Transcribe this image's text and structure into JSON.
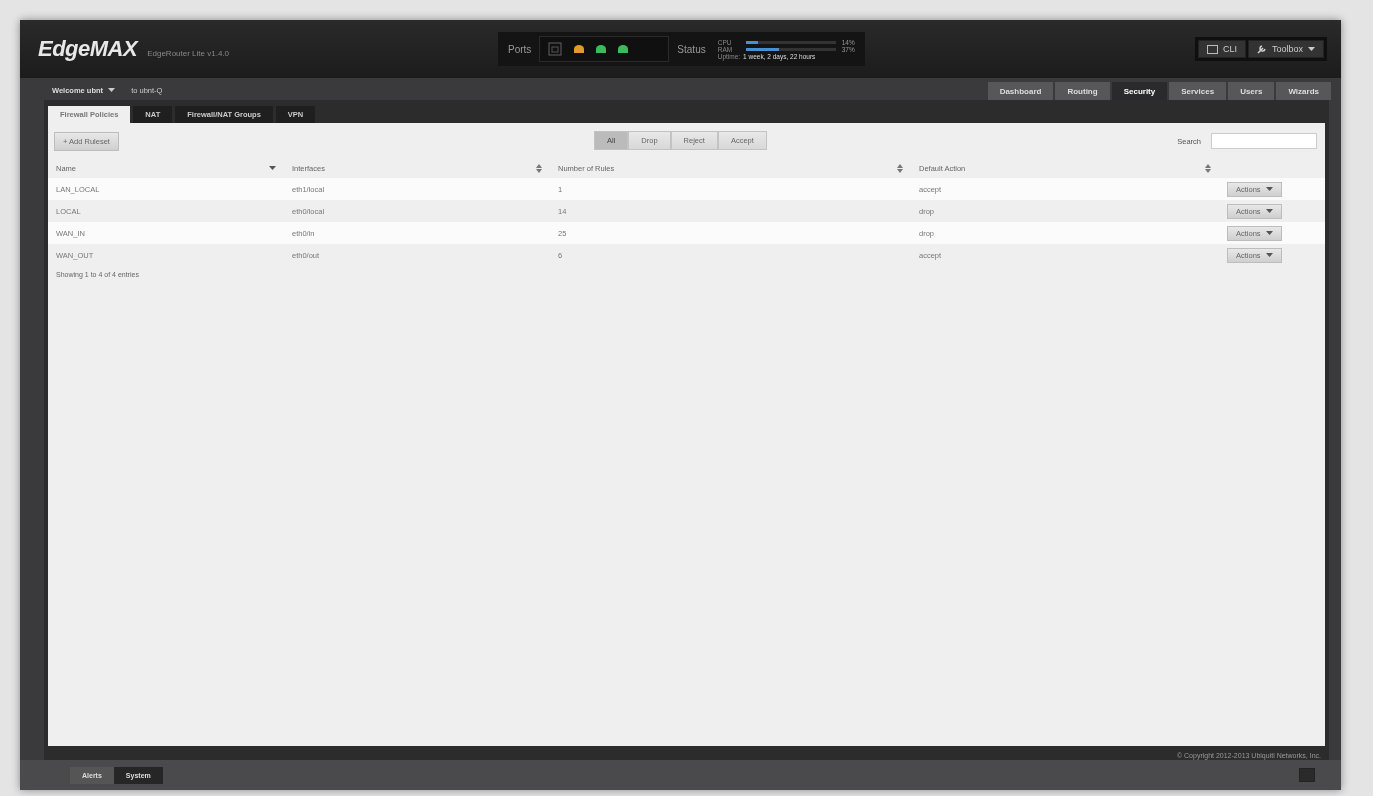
{
  "header": {
    "logo": "EdgeMAX",
    "product": "EdgeRouter Lite v1.4.0",
    "ports": {
      "label": "Ports",
      "leds": [
        {
          "color": "#e39a2c"
        },
        {
          "color": "#3dbb5a"
        },
        {
          "color": "#3dbb5a"
        }
      ]
    },
    "status": {
      "label": "Status",
      "meters": [
        {
          "name": "CPU",
          "level": 0.14,
          "reading": "14%"
        },
        {
          "name": "RAM",
          "level": 0.37,
          "reading": "37%"
        }
      ],
      "uptime_label": "Uptime:",
      "uptime": "1 week, 2 days, 22 hours"
    },
    "buttons": [
      {
        "kind": "cli",
        "label": "CLI"
      },
      {
        "kind": "toolbox",
        "label": "Toolbox"
      }
    ]
  },
  "user": {
    "welcome": "Welcome ubnt",
    "host": "to ubnt-Q"
  },
  "nav_tabs": [
    {
      "label": "Dashboard",
      "selected": false
    },
    {
      "label": "Routing",
      "selected": false
    },
    {
      "label": "Security",
      "selected": true
    },
    {
      "label": "Services",
      "selected": false
    },
    {
      "label": "Users",
      "selected": false
    },
    {
      "label": "Wizards",
      "selected": false
    }
  ],
  "sub_tabs": [
    {
      "label": "Firewall Policies",
      "selected": true
    },
    {
      "label": "NAT",
      "selected": false
    },
    {
      "label": "Firewall/NAT Groups",
      "selected": false
    },
    {
      "label": "VPN",
      "selected": false
    }
  ],
  "add_button": "+ Add Ruleset",
  "filters": [
    {
      "label": "All",
      "selected": true
    },
    {
      "label": "Drop",
      "selected": false
    },
    {
      "label": "Reject",
      "selected": false
    },
    {
      "label": "Accept",
      "selected": false
    }
  ],
  "search": {
    "label": "Search"
  },
  "table": {
    "columns": [
      {
        "label": "Name",
        "sorted": true
      },
      {
        "label": "Interfaces",
        "sorted": false
      },
      {
        "label": "Number of Rules",
        "sorted": false
      },
      {
        "label": "Default Action",
        "sorted": false
      }
    ],
    "rows": [
      {
        "cells": [
          "LAN_LOCAL",
          "eth1/local",
          "1",
          "accept"
        ],
        "action": "Actions"
      },
      {
        "cells": [
          "LOCAL",
          "eth0/local",
          "14",
          "drop"
        ],
        "action": "Actions"
      },
      {
        "cells": [
          "WAN_IN",
          "eth0/in",
          "25",
          "drop"
        ],
        "action": "Actions"
      },
      {
        "cells": [
          "WAN_OUT",
          "eth0/out",
          "6",
          "accept"
        ],
        "action": "Actions"
      }
    ],
    "info": "Showing 1 to 4 of 4 entries"
  },
  "copyright": "© Copyright 2012-2013 Ubiquiti Networks, Inc.",
  "bottom_tabs": [
    {
      "label": "Alerts",
      "selected": false
    },
    {
      "label": "System",
      "selected": true
    }
  ]
}
